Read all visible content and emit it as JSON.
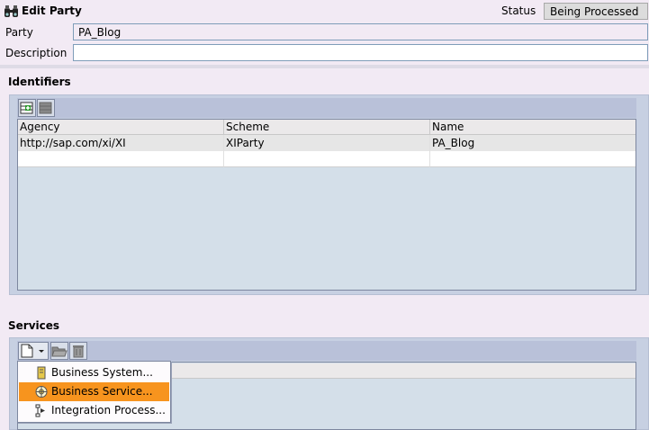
{
  "header": {
    "title": "Edit Party",
    "status_label": "Status",
    "status_value": "Being Processed"
  },
  "form": {
    "party_label": "Party",
    "party_value": "PA_Blog",
    "description_label": "Description",
    "description_value": ""
  },
  "identifiers": {
    "title": "Identifiers",
    "toolbar": {
      "insert_icon": "insert-row-icon",
      "delete_icon": "delete-row-icon"
    },
    "columns": [
      "Agency",
      "Scheme",
      "Name"
    ],
    "rows": [
      [
        "http://sap.com/xi/XI",
        "XIParty",
        "PA_Blog"
      ],
      [
        "",
        "",
        ""
      ]
    ]
  },
  "services": {
    "title": "Services",
    "toolbar": {
      "new_icon": "new-document-icon",
      "dropdown_icon": "dropdown-arrow-icon",
      "open_icon": "open-folder-icon",
      "delete_icon": "trash-icon"
    },
    "menu": {
      "items": [
        {
          "label": "Business System...",
          "icon": "business-system-icon"
        },
        {
          "label": "Business Service...",
          "icon": "business-service-icon",
          "selected": true
        },
        {
          "label": "Integration Process...",
          "icon": "integration-process-icon"
        }
      ]
    }
  },
  "colors": {
    "background": "#f2eaf4",
    "panel": "#c7d0e2",
    "table": "#d4dfe9",
    "highlight": "#f7941e"
  }
}
